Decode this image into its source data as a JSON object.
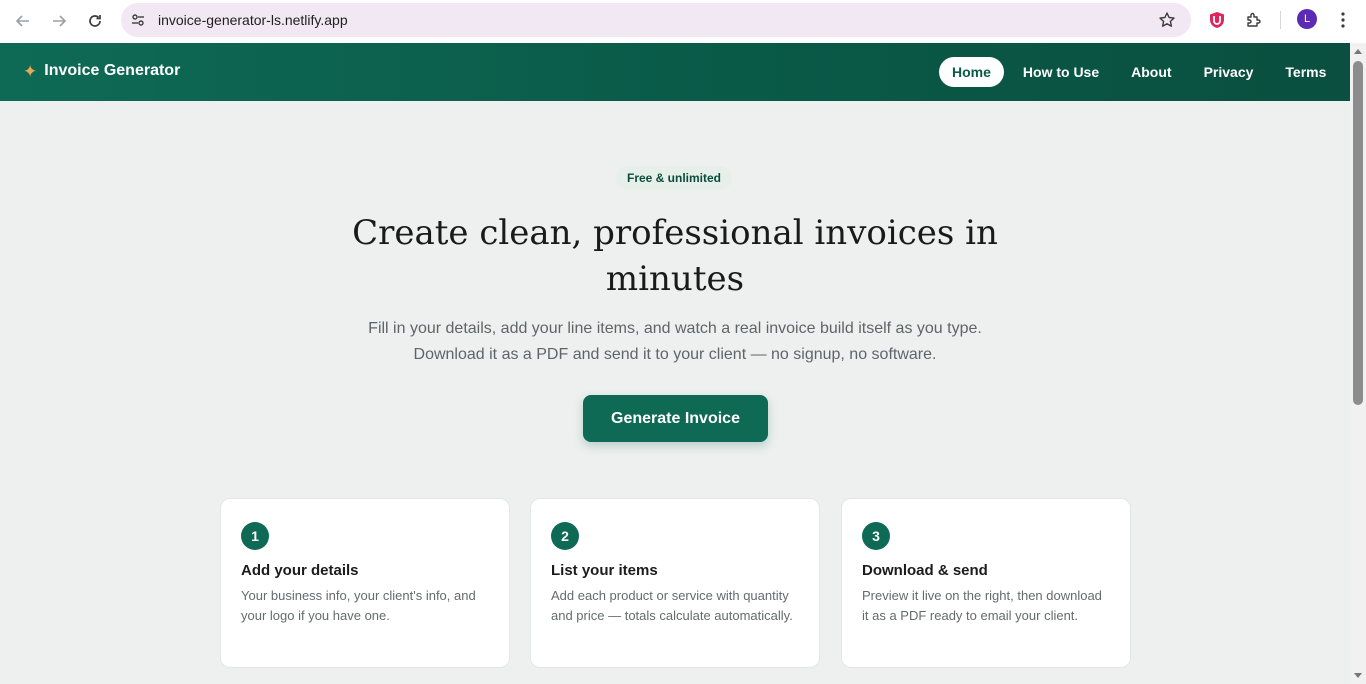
{
  "browser": {
    "url": "invoice-generator-ls.netlify.app",
    "avatar_letter": "L"
  },
  "header": {
    "brand": "Invoice Generator",
    "nav": [
      {
        "label": "Home",
        "active": true
      },
      {
        "label": "How to Use",
        "active": false
      },
      {
        "label": "About",
        "active": false
      },
      {
        "label": "Privacy",
        "active": false
      },
      {
        "label": "Terms",
        "active": false
      }
    ]
  },
  "hero": {
    "badge": "Free & unlimited",
    "title": "Create clean, professional invoices in minutes",
    "subtitle": "Fill in your details, add your line items, and watch a real invoice build itself as you type. Download it as a PDF and send it to your client — no signup, no software.",
    "cta": "Generate Invoice"
  },
  "steps": [
    {
      "number": "1",
      "title": "Add your details",
      "desc": "Your business info, your client's info, and your logo if you have one."
    },
    {
      "number": "2",
      "title": "List your items",
      "desc": "Add each product or service with quantity and price — totals calculate automatically."
    },
    {
      "number": "3",
      "title": "Download & send",
      "desc": "Preview it live on the right, then download it as a PDF ready to email your client."
    }
  ],
  "colors": {
    "brand_green": "#0f6a55",
    "accent_spark": "#e6a85a",
    "page_bg": "#eef0ef"
  }
}
